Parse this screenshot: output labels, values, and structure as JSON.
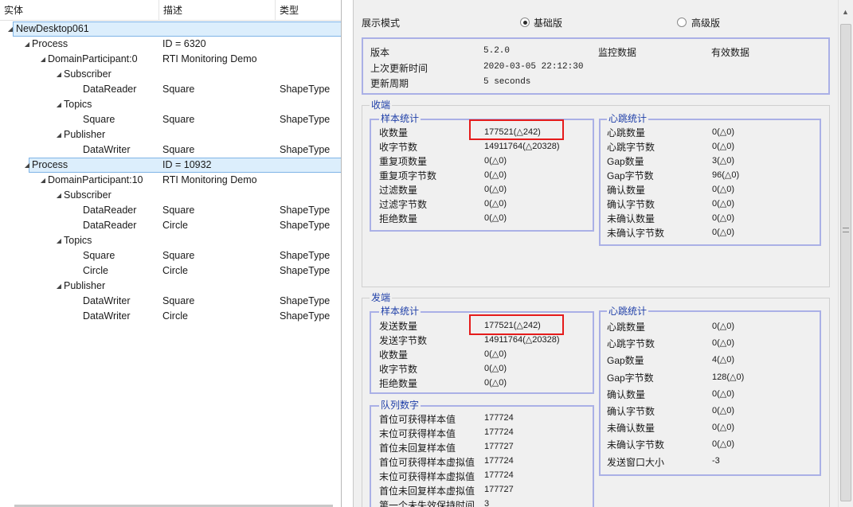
{
  "tree": {
    "columns": [
      "实体",
      "描述",
      "类型"
    ],
    "rows": [
      {
        "name": "NewDesktop061",
        "desc": "",
        "type": "",
        "level": 0,
        "expanded": true,
        "selected": true
      },
      {
        "name": "Process",
        "desc": "ID = 6320",
        "type": "",
        "level": 1,
        "expanded": true
      },
      {
        "name": "DomainParticipant:0",
        "desc": "RTI Monitoring Demo",
        "type": "",
        "level": 2,
        "expanded": true
      },
      {
        "name": "Subscriber",
        "desc": "",
        "type": "",
        "level": 3,
        "expanded": true
      },
      {
        "name": "DataReader",
        "desc": "Square",
        "type": "ShapeType",
        "level": 4
      },
      {
        "name": "Topics",
        "desc": "",
        "type": "",
        "level": 3,
        "expanded": true
      },
      {
        "name": "Square",
        "desc": "Square",
        "type": "ShapeType",
        "level": 4
      },
      {
        "name": "Publisher",
        "desc": "",
        "type": "",
        "level": 3,
        "expanded": true
      },
      {
        "name": "DataWriter",
        "desc": "Square",
        "type": "ShapeType",
        "level": 4
      },
      {
        "name": "Process",
        "desc": "ID = 10932",
        "type": "",
        "level": 1,
        "expanded": true,
        "selected": true
      },
      {
        "name": "DomainParticipant:10",
        "desc": "RTI Monitoring Demo",
        "type": "",
        "level": 2,
        "expanded": true
      },
      {
        "name": "Subscriber",
        "desc": "",
        "type": "",
        "level": 3,
        "expanded": true
      },
      {
        "name": "DataReader",
        "desc": "Square",
        "type": "ShapeType",
        "level": 4
      },
      {
        "name": "DataReader",
        "desc": "Circle",
        "type": "ShapeType",
        "level": 4
      },
      {
        "name": "Topics",
        "desc": "",
        "type": "",
        "level": 3,
        "expanded": true
      },
      {
        "name": "Square",
        "desc": "Square",
        "type": "ShapeType",
        "level": 4
      },
      {
        "name": "Circle",
        "desc": "Circle",
        "type": "ShapeType",
        "level": 4
      },
      {
        "name": "Publisher",
        "desc": "",
        "type": "",
        "level": 3,
        "expanded": true
      },
      {
        "name": "DataWriter",
        "desc": "Square",
        "type": "ShapeType",
        "level": 4
      },
      {
        "name": "DataWriter",
        "desc": "Circle",
        "type": "ShapeType",
        "level": 4
      }
    ]
  },
  "display_mode": {
    "label": "展示模式",
    "options": [
      {
        "label": "基础版",
        "selected": true
      },
      {
        "label": "高级版",
        "selected": false
      }
    ]
  },
  "info": {
    "version_label": "版本",
    "version": "5.2.0",
    "updated_label": "上次更新时间",
    "updated": "2020-03-05 22:12:30",
    "period_label": "更新周期",
    "period": "5 seconds",
    "monitor_label": "监控数据",
    "monitor": "有效数据"
  },
  "receive": {
    "title": "收端",
    "samples_title": "样本统计",
    "samples": [
      {
        "label": "收数量",
        "value": "177521(△242)"
      },
      {
        "label": "收字节数",
        "value": "14911764(△20328)"
      },
      {
        "label": "重复项数量",
        "value": "0(△0)"
      },
      {
        "label": "重复项字节数",
        "value": "0(△0)"
      },
      {
        "label": "过滤数量",
        "value": "0(△0)"
      },
      {
        "label": "过滤字节数",
        "value": "0(△0)"
      },
      {
        "label": "拒绝数量",
        "value": "0(△0)"
      }
    ],
    "heartbeat_title": "心跳统计",
    "heartbeat": [
      {
        "label": "心跳数量",
        "value": "0(△0)"
      },
      {
        "label": "心跳字节数",
        "value": "0(△0)"
      },
      {
        "label": "Gap数量",
        "value": "3(△0)"
      },
      {
        "label": "Gap字节数",
        "value": "96(△0)"
      },
      {
        "label": "确认数量",
        "value": "0(△0)"
      },
      {
        "label": "确认字节数",
        "value": "0(△0)"
      },
      {
        "label": "未确认数量",
        "value": "0(△0)"
      },
      {
        "label": "未确认字节数",
        "value": "0(△0)"
      }
    ]
  },
  "send": {
    "title": "发端",
    "samples_title": "样本统计",
    "samples": [
      {
        "label": "发送数量",
        "value": "177521(△242)"
      },
      {
        "label": "发送字节数",
        "value": "14911764(△20328)"
      },
      {
        "label": "收数量",
        "value": "0(△0)"
      },
      {
        "label": "收字节数",
        "value": "0(△0)"
      },
      {
        "label": "拒绝数量",
        "value": "0(△0)"
      }
    ],
    "queue_title": "队列数字",
    "queue": [
      {
        "label": "首位可获得样本值",
        "value": "177724"
      },
      {
        "label": "末位可获得样本值",
        "value": "177724"
      },
      {
        "label": "首位未回复样本值",
        "value": "177727"
      },
      {
        "label": "首位可获得样本虚拟值",
        "value": "177724"
      },
      {
        "label": "末位可获得样本虚拟值",
        "value": "177724"
      },
      {
        "label": "首位未回复样本虚拟值",
        "value": "177727"
      },
      {
        "label": "第一个未失效保持时间",
        "value": "3"
      }
    ],
    "heartbeat_title": "心跳统计",
    "heartbeat": [
      {
        "label": "心跳数量",
        "value": "0(△0)"
      },
      {
        "label": "心跳字节数",
        "value": "0(△0)"
      },
      {
        "label": "Gap数量",
        "value": "4(△0)"
      },
      {
        "label": "Gap字节数",
        "value": "128(△0)"
      },
      {
        "label": "确认数量",
        "value": "0(△0)"
      },
      {
        "label": "确认字节数",
        "value": "0(△0)"
      },
      {
        "label": "未确认数量",
        "value": "0(△0)"
      },
      {
        "label": "未确认字节数",
        "value": "0(△0)"
      },
      {
        "label": "发送窗口大小",
        "value": "-3"
      }
    ]
  },
  "colors": {
    "group_title": "#1f3fa8",
    "group_border": "#aab0e6",
    "highlight": "#e51b1b",
    "selection": "#dceefc"
  }
}
